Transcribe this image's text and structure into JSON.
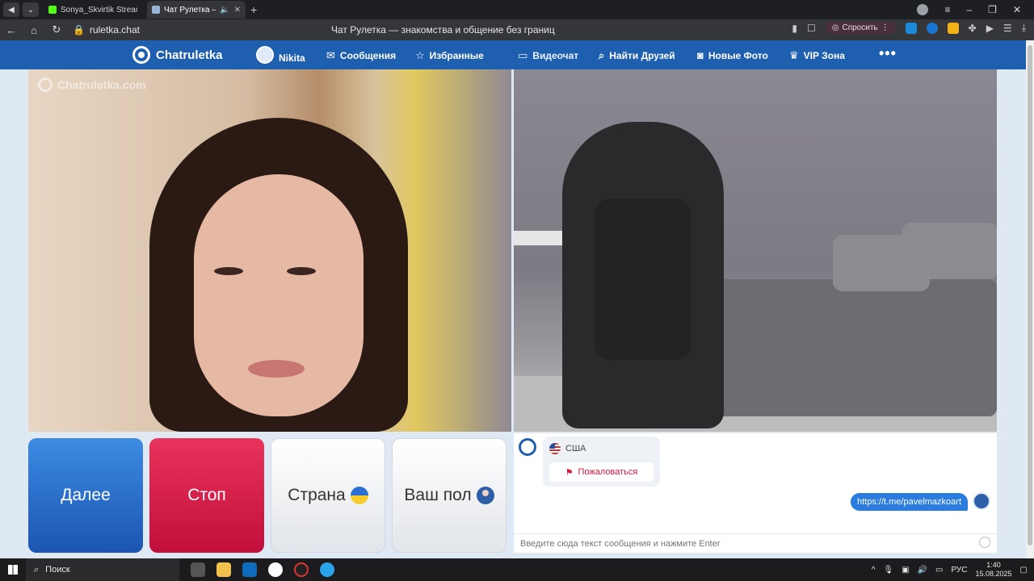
{
  "browser": {
    "tabs": [
      {
        "title": "Sonya_Skvirtik Stream - Ki",
        "favicon_color": "#53fc18"
      },
      {
        "title": "Чат Рулетка — знакс",
        "favicon_color": "#9ab4d8"
      }
    ],
    "address": "ruletka.chat",
    "page_title": "Чат Рулетка — знакомства и общение без границ",
    "ask_label": "Спросить"
  },
  "site": {
    "logo_text": "Chatruletka",
    "nav": [
      {
        "label": "Nikita"
      },
      {
        "label": "Сообщения"
      },
      {
        "label": "Избранные"
      },
      {
        "label": "Видеочат"
      },
      {
        "label": "Найти Друзей"
      },
      {
        "label": "Новые Фото"
      },
      {
        "label": "VIP Зона"
      }
    ],
    "more": "•••",
    "watermark": "Chatruletka.com"
  },
  "controls": {
    "next": "Далее",
    "stop": "Стоп",
    "country": "Страна",
    "gender": "Ваш пол"
  },
  "chat": {
    "country": "США",
    "report": "Пожаловаться",
    "message": "https://t.me/pavelmazkoart",
    "input_placeholder": "Введите сюда текст сообщения и нажмите Enter"
  },
  "taskbar": {
    "search": "Поиск",
    "lang": "РУС",
    "time": "1:40",
    "date": "15.08.2025"
  },
  "colors": {
    "brand": "#1f5fb0",
    "next": "#2a6fd1",
    "stop": "#d61c48"
  }
}
